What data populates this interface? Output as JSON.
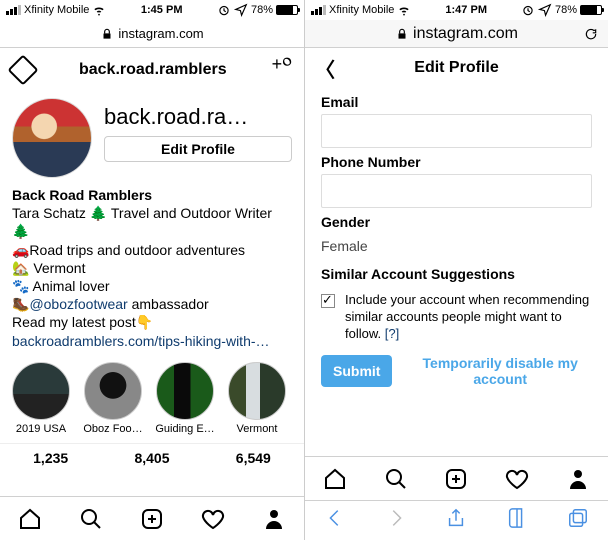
{
  "left": {
    "status": {
      "carrier": "Xfinity Mobile",
      "time": "1:45 PM",
      "battery": "78%"
    },
    "url": "instagram.com",
    "header": {
      "username": "back.road.ramblers"
    },
    "profile": {
      "username_display": "back.road.ra…",
      "edit_button": "Edit Profile",
      "display_name": "Back Road Ramblers",
      "bio_line1": "Tara Schatz 🌲 Travel and Outdoor Writer 🌲",
      "bio_line2": "🚗Road trips and outdoor adventures",
      "bio_line3": "🏡 Vermont",
      "bio_line4": "🐾 Animal lover",
      "bio_line5_pre": "🥾",
      "bio_line5_mention": "@obozfootwear",
      "bio_line5_post": " ambassador",
      "bio_line6": "Read my latest post👇",
      "bio_link": "backroadramblers.com/tips-hiking-with-…"
    },
    "stories": [
      {
        "label": "2019 USA"
      },
      {
        "label": "Oboz Foo…"
      },
      {
        "label": "Guiding E…"
      },
      {
        "label": "Vermont"
      }
    ],
    "stats": {
      "posts": "1,235",
      "followers": "8,405",
      "following": "6,549"
    }
  },
  "right": {
    "status": {
      "carrier": "Xfinity Mobile",
      "time": "1:47 PM",
      "battery": "78%"
    },
    "url": "instagram.com",
    "title": "Edit Profile",
    "email_label": "Email",
    "phone_label": "Phone Number",
    "gender_label": "Gender",
    "gender_value": "Female",
    "suggest_label": "Similar Account Suggestions",
    "suggest_text": "Include your account when recommending similar accounts people might want to follow.  ",
    "suggest_help": "[?]",
    "submit": "Submit",
    "disable": "Temporarily disable my account"
  }
}
